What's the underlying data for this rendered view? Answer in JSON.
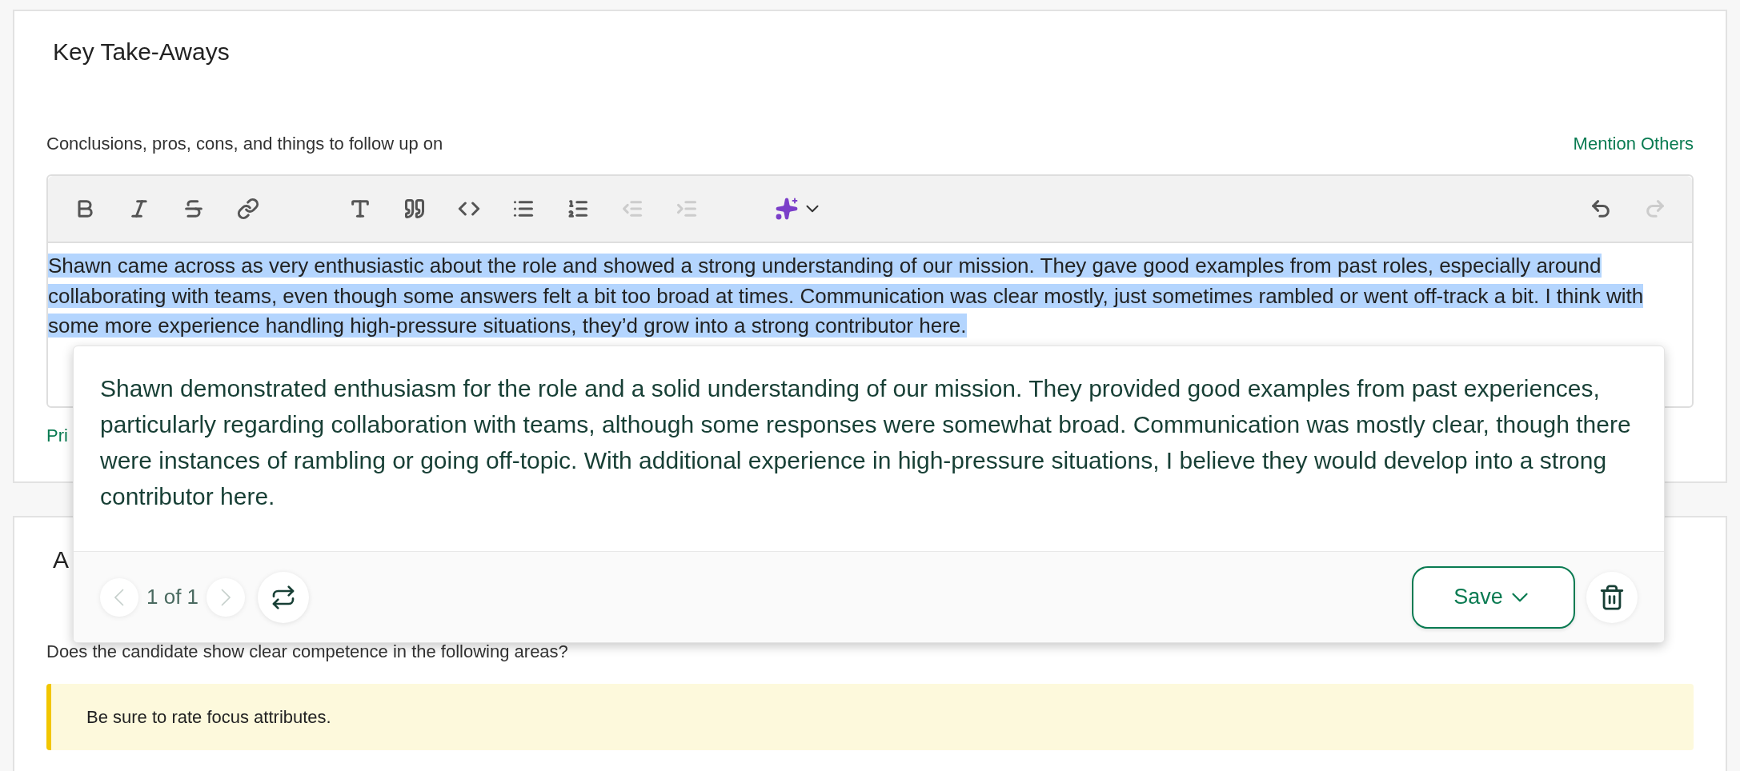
{
  "section": {
    "title": "Key Take-Aways",
    "field_label": "Conclusions, pros, cons, and things to follow up on",
    "mention_link": "Mention Others",
    "toolbar": {
      "groups": [
        [
          {
            "kind": "bold",
            "disabled": false
          },
          {
            "kind": "italic",
            "disabled": false
          },
          {
            "kind": "strike",
            "disabled": false
          },
          {
            "kind": "link",
            "disabled": false
          }
        ],
        [
          {
            "kind": "heading",
            "disabled": false
          },
          {
            "kind": "quote",
            "disabled": false
          },
          {
            "kind": "code",
            "disabled": false
          },
          {
            "kind": "bullets",
            "disabled": false
          },
          {
            "kind": "numbers",
            "disabled": false
          },
          {
            "kind": "outdent",
            "disabled": true
          },
          {
            "kind": "indent",
            "disabled": true
          }
        ],
        [
          {
            "kind": "ai",
            "disabled": false
          }
        ],
        [
          {
            "kind": "undo",
            "disabled": false
          },
          {
            "kind": "redo",
            "disabled": true
          }
        ]
      ]
    },
    "editor_text": "Shawn came across as very enthusiastic about the role and showed a strong understanding of our mission. They gave good examples from past roles, especially around collaborating with teams, even though some answers felt a bit too broad at times. Communication was clear mostly, just sometimes rambled or went off-track a bit. I think with some more experience handling high-pressure situations, they’d grow into a strong contributor here.",
    "text_selected": true,
    "below_editor": "Pri"
  },
  "suggestion_popup": {
    "text": "Shawn demonstrated enthusiasm for the role and a solid understanding of our mission. They provided good examples from past experiences, particularly regarding collaboration with teams, although some responses were somewhat broad. Communication was mostly clear, though there were instances of rambling or going off-topic. With additional experience in high-pressure situations, I believe they would develop into a strong contributor here.",
    "prev_disabled": true,
    "counter": "1 of 1",
    "next_disabled": true,
    "save_label": "Save"
  },
  "section_2": {
    "title": "A",
    "question": "Does the candidate show clear competence in the following areas?",
    "notice": "Be sure to rate focus attributes."
  }
}
